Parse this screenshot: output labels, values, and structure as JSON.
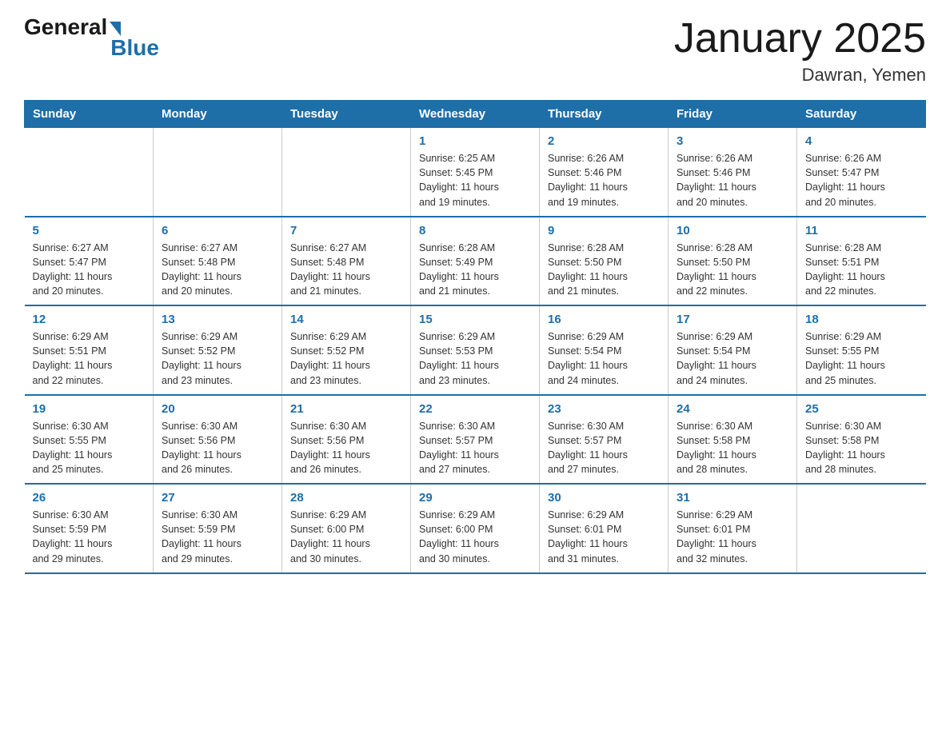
{
  "logo": {
    "general": "General",
    "blue": "Blue"
  },
  "title": "January 2025",
  "subtitle": "Dawran, Yemen",
  "days_header": [
    "Sunday",
    "Monday",
    "Tuesday",
    "Wednesday",
    "Thursday",
    "Friday",
    "Saturday"
  ],
  "weeks": [
    [
      {
        "day": "",
        "info": ""
      },
      {
        "day": "",
        "info": ""
      },
      {
        "day": "",
        "info": ""
      },
      {
        "day": "1",
        "info": "Sunrise: 6:25 AM\nSunset: 5:45 PM\nDaylight: 11 hours\nand 19 minutes."
      },
      {
        "day": "2",
        "info": "Sunrise: 6:26 AM\nSunset: 5:46 PM\nDaylight: 11 hours\nand 19 minutes."
      },
      {
        "day": "3",
        "info": "Sunrise: 6:26 AM\nSunset: 5:46 PM\nDaylight: 11 hours\nand 20 minutes."
      },
      {
        "day": "4",
        "info": "Sunrise: 6:26 AM\nSunset: 5:47 PM\nDaylight: 11 hours\nand 20 minutes."
      }
    ],
    [
      {
        "day": "5",
        "info": "Sunrise: 6:27 AM\nSunset: 5:47 PM\nDaylight: 11 hours\nand 20 minutes."
      },
      {
        "day": "6",
        "info": "Sunrise: 6:27 AM\nSunset: 5:48 PM\nDaylight: 11 hours\nand 20 minutes."
      },
      {
        "day": "7",
        "info": "Sunrise: 6:27 AM\nSunset: 5:48 PM\nDaylight: 11 hours\nand 21 minutes."
      },
      {
        "day": "8",
        "info": "Sunrise: 6:28 AM\nSunset: 5:49 PM\nDaylight: 11 hours\nand 21 minutes."
      },
      {
        "day": "9",
        "info": "Sunrise: 6:28 AM\nSunset: 5:50 PM\nDaylight: 11 hours\nand 21 minutes."
      },
      {
        "day": "10",
        "info": "Sunrise: 6:28 AM\nSunset: 5:50 PM\nDaylight: 11 hours\nand 22 minutes."
      },
      {
        "day": "11",
        "info": "Sunrise: 6:28 AM\nSunset: 5:51 PM\nDaylight: 11 hours\nand 22 minutes."
      }
    ],
    [
      {
        "day": "12",
        "info": "Sunrise: 6:29 AM\nSunset: 5:51 PM\nDaylight: 11 hours\nand 22 minutes."
      },
      {
        "day": "13",
        "info": "Sunrise: 6:29 AM\nSunset: 5:52 PM\nDaylight: 11 hours\nand 23 minutes."
      },
      {
        "day": "14",
        "info": "Sunrise: 6:29 AM\nSunset: 5:52 PM\nDaylight: 11 hours\nand 23 minutes."
      },
      {
        "day": "15",
        "info": "Sunrise: 6:29 AM\nSunset: 5:53 PM\nDaylight: 11 hours\nand 23 minutes."
      },
      {
        "day": "16",
        "info": "Sunrise: 6:29 AM\nSunset: 5:54 PM\nDaylight: 11 hours\nand 24 minutes."
      },
      {
        "day": "17",
        "info": "Sunrise: 6:29 AM\nSunset: 5:54 PM\nDaylight: 11 hours\nand 24 minutes."
      },
      {
        "day": "18",
        "info": "Sunrise: 6:29 AM\nSunset: 5:55 PM\nDaylight: 11 hours\nand 25 minutes."
      }
    ],
    [
      {
        "day": "19",
        "info": "Sunrise: 6:30 AM\nSunset: 5:55 PM\nDaylight: 11 hours\nand 25 minutes."
      },
      {
        "day": "20",
        "info": "Sunrise: 6:30 AM\nSunset: 5:56 PM\nDaylight: 11 hours\nand 26 minutes."
      },
      {
        "day": "21",
        "info": "Sunrise: 6:30 AM\nSunset: 5:56 PM\nDaylight: 11 hours\nand 26 minutes."
      },
      {
        "day": "22",
        "info": "Sunrise: 6:30 AM\nSunset: 5:57 PM\nDaylight: 11 hours\nand 27 minutes."
      },
      {
        "day": "23",
        "info": "Sunrise: 6:30 AM\nSunset: 5:57 PM\nDaylight: 11 hours\nand 27 minutes."
      },
      {
        "day": "24",
        "info": "Sunrise: 6:30 AM\nSunset: 5:58 PM\nDaylight: 11 hours\nand 28 minutes."
      },
      {
        "day": "25",
        "info": "Sunrise: 6:30 AM\nSunset: 5:58 PM\nDaylight: 11 hours\nand 28 minutes."
      }
    ],
    [
      {
        "day": "26",
        "info": "Sunrise: 6:30 AM\nSunset: 5:59 PM\nDaylight: 11 hours\nand 29 minutes."
      },
      {
        "day": "27",
        "info": "Sunrise: 6:30 AM\nSunset: 5:59 PM\nDaylight: 11 hours\nand 29 minutes."
      },
      {
        "day": "28",
        "info": "Sunrise: 6:29 AM\nSunset: 6:00 PM\nDaylight: 11 hours\nand 30 minutes."
      },
      {
        "day": "29",
        "info": "Sunrise: 6:29 AM\nSunset: 6:00 PM\nDaylight: 11 hours\nand 30 minutes."
      },
      {
        "day": "30",
        "info": "Sunrise: 6:29 AM\nSunset: 6:01 PM\nDaylight: 11 hours\nand 31 minutes."
      },
      {
        "day": "31",
        "info": "Sunrise: 6:29 AM\nSunset: 6:01 PM\nDaylight: 11 hours\nand 32 minutes."
      },
      {
        "day": "",
        "info": ""
      }
    ]
  ]
}
